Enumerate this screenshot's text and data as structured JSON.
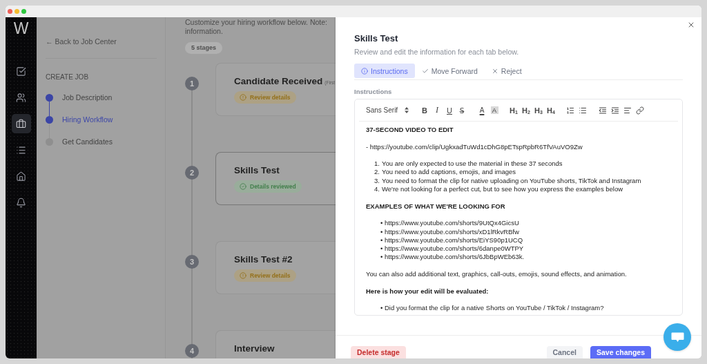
{
  "app_sidebar": {
    "logo": "W",
    "items": [
      {
        "selected": false
      },
      {
        "selected": false
      },
      {
        "selected": true
      },
      {
        "selected": false
      },
      {
        "selected": false
      },
      {
        "selected": false
      }
    ]
  },
  "nav": {
    "back_link": "← Back to Job Center",
    "section_title": "CREATE JOB",
    "steps": [
      {
        "label": "Job Description",
        "reached": true,
        "selected": false
      },
      {
        "label": "Hiring Workflow",
        "reached": true,
        "selected": true
      },
      {
        "label": "Get Candidates",
        "reached": false,
        "selected": false
      }
    ]
  },
  "workflow": {
    "intro_lines": [
      "Customize your hiring workflow below. Note:",
      "information."
    ],
    "stage_count": "5 stages",
    "stages": [
      {
        "number": "1",
        "title": "Candidate Received",
        "note": "(First",
        "badge": {
          "kind": "pending",
          "label": "Review details"
        },
        "selected": false
      },
      {
        "number": "2",
        "title": "Skills Test",
        "badge": {
          "kind": "done",
          "label": "Details reviewed"
        },
        "selected": true
      },
      {
        "number": "3",
        "title": "Skills Test #2",
        "badge": {
          "kind": "pending",
          "label": "Review details"
        },
        "selected": false
      },
      {
        "number": "4",
        "title": "Interview",
        "selected": false
      }
    ]
  },
  "drawer": {
    "title": "Skills Test",
    "subtitle": "Review and edit the information for each tab below.",
    "tabs": [
      {
        "label": "Instructions",
        "selected": true
      },
      {
        "label": "Move Forward",
        "selected": false
      },
      {
        "label": "Reject",
        "selected": false
      }
    ],
    "field_label": "Instructions",
    "toolbar": {
      "font": "Sans Serif",
      "button_groups": [
        [
          {
            "kind": "bold",
            "label": "B"
          },
          {
            "kind": "italic",
            "label": "I"
          },
          {
            "kind": "underline",
            "label": "U"
          },
          {
            "kind": "strike",
            "label": "S̶"
          }
        ],
        [
          {
            "kind": "color",
            "label": "A"
          },
          {
            "kind": "background",
            "label": "A"
          }
        ],
        [
          {
            "kind": "heading",
            "label": "H$_{1}$"
          },
          {
            "kind": "heading",
            "label": "H$_{2}$"
          },
          {
            "kind": "heading",
            "label": "H$_{3}$"
          },
          {
            "kind": "heading",
            "label": "H$_{4}$"
          }
        ]
      ]
    },
    "content": [
      {
        "kind": "heading",
        "text": "37-SECOND VIDEO TO EDIT"
      },
      {
        "kind": "paragraph",
        "text": "- https://youtube.com/clip/UgkxadTuWd1cDhG8pETspRpbR6TfVAuVO9Zw"
      },
      {
        "kind": "ordered_list",
        "items": [
          {
            "marker": "1.",
            "text": "You are only expected to use the material in these 37 seconds"
          },
          {
            "marker": "2.",
            "text": "You need to add captions, emojis, and images"
          },
          {
            "marker": "3.",
            "text": "You need to format the clip for native uploading on YouTube shorts, TikTok and Instagram"
          },
          {
            "marker": "4.",
            "text": "We're not looking for a perfect cut, but to see how you express the examples below"
          }
        ]
      },
      {
        "kind": "heading",
        "text": "EXAMPLES OF WHAT WE'RE LOOKING FOR"
      },
      {
        "kind": "bullet_list",
        "items": [
          {
            "marker": "•",
            "text": "https://www.youtube.com/shorts/9UtQx4GicsU"
          },
          {
            "marker": "•",
            "text": "https://www.youtube.com/shorts/xD1lRkvRBfw"
          },
          {
            "marker": "•",
            "text": "https://www.youtube.com/shorts/EiYS90p1UCQ"
          },
          {
            "marker": "•",
            "text": "https://www.youtube.com/shorts/6danpe0WTPY"
          },
          {
            "marker": "•",
            "text": "https://www.youtube.com/shorts/6JbBpWEb63k."
          }
        ]
      },
      {
        "kind": "paragraph",
        "text": "You can also add additional text, graphics, call-outs, emojis, sound effects, and animation."
      },
      {
        "kind": "heading",
        "text": "Here is how your edit will be evaluated:"
      },
      {
        "kind": "bullet_list",
        "items": [
          {
            "marker": "•",
            "text": "Did you format the clip for a native Shorts on YouTube / TikTok / Instagram?"
          }
        ]
      }
    ],
    "buttons": [
      {
        "kind": "danger",
        "label": "Delete stage"
      },
      {
        "kind": "secondary",
        "label": "Cancel"
      },
      {
        "kind": "primary",
        "label": "Save changes"
      }
    ]
  }
}
